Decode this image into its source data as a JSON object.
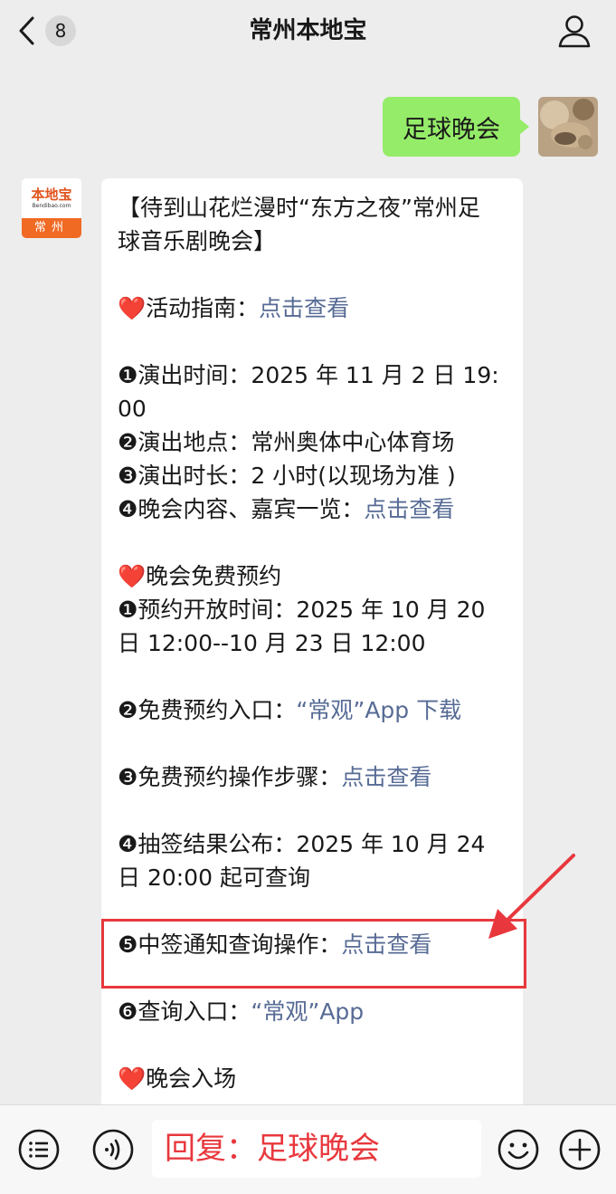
{
  "header": {
    "back_badge": "8",
    "title": "常州本地宝"
  },
  "messages": {
    "outgoing": {
      "text": "足球晚会"
    },
    "incoming": {
      "avatar": {
        "logo_text": "本地宝",
        "logo_url": "Bendibao.com",
        "city": "常州"
      },
      "lines": {
        "l1": "【待到山花烂漫时“东方之夜”常州足",
        "l2": "球音乐剧晚会】",
        "guide_heart": "❤️",
        "guide_label": "活动指南：",
        "guide_link": "点击查看",
        "time1": "❶演出时间：2025 年 11 月 2 日 19:",
        "time2": "00",
        "place": "❷演出地点：常州奥体中心体育场",
        "duration": "❸演出时长：2 小时(以现场为准 )",
        "content_label": "❹晚会内容、嘉宾一览：",
        "content_link": "点击查看",
        "reserve_heart": "❤️",
        "reserve_label": "晚会免费预约",
        "open1": "❶预约开放时间：2025 年 10 月 20",
        "open2": "日 12:00--10 月 23 日 12:00",
        "entry_label": "❷免费预约入口：",
        "entry_link": "“常观”App 下载",
        "steps_label": "❸免费预约操作步骤：",
        "steps_link": "点击查看",
        "result1": "❹抽签结果公布：2025 年 10 月 24",
        "result2": "日 20:00 起可查询",
        "notice_label": "❺中签通知查询操作：",
        "notice_link": "点击查看",
        "query_label": "❻查询入口：",
        "query_link": "“常观”App",
        "enter_heart": "❤️",
        "enter_label": "晚会入场"
      }
    }
  },
  "input_bar": {
    "text": "回复：足球晚会"
  },
  "colors": {
    "background": "#ededed",
    "outgoing_bubble": "#95ec69",
    "link": "#576b95",
    "highlight": "#e8383d"
  },
  "icons": [
    "chevron-left-icon",
    "person-icon",
    "list-icon",
    "voice-icon",
    "emoji-icon",
    "plus-icon"
  ]
}
